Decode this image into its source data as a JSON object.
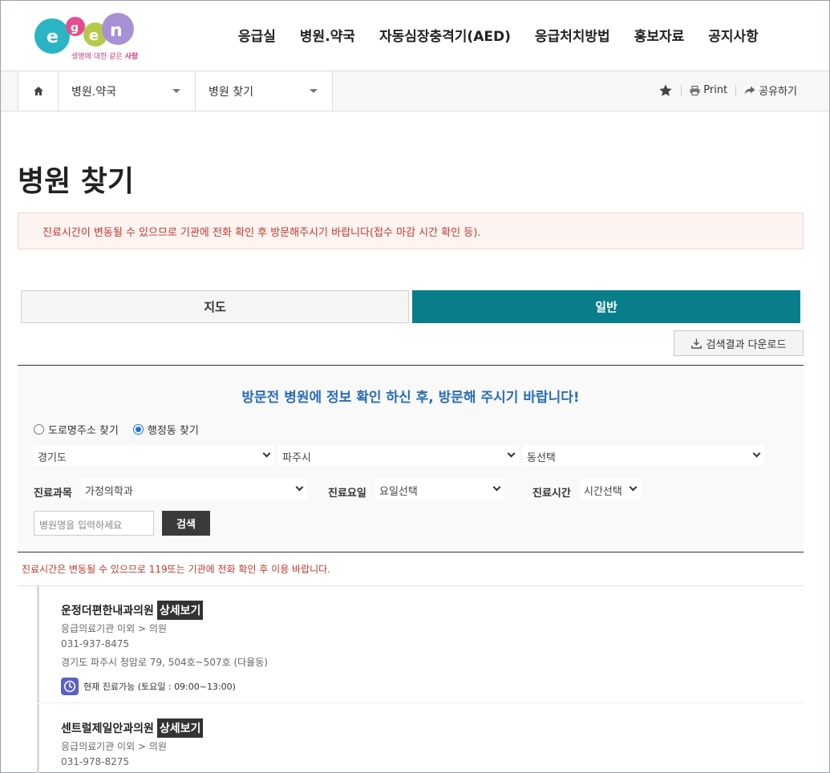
{
  "header": {
    "logo_tagline_a": "생명에 대한 같은",
    "logo_tagline_b": "사랑",
    "nav": [
      "응급실",
      "병원.약국",
      "자동심장충격기(AED)",
      "응급처치방법",
      "홍보자료",
      "공지사항"
    ]
  },
  "breadcrumb": {
    "level1": "병원.약국",
    "level2": "병원 찾기",
    "print": "Print",
    "share": "공유하기"
  },
  "page": {
    "title": "병원 찾기",
    "notice": "진료시간이 변동될 수 있으므로 기관에 전화 확인 후 방문해주시기 바랍니다(접수 마감 시간 확인 등)."
  },
  "tabs": {
    "map": "지도",
    "general": "일반"
  },
  "download_label": "검색결과 다운로드",
  "search": {
    "title": "방문전 병원에 정보 확인 하신 후, 방문해 주시기 바랍니다!",
    "radio_road": "도로명주소 찾기",
    "radio_admin": "행정동 찾기",
    "province": "경기도",
    "city": "파주시",
    "dong": "동선택",
    "dept_label": "진료과목",
    "dept_value": "가정의학과",
    "day_label": "진료요일",
    "day_value": "요일선택",
    "time_label": "진료시간",
    "time_value": "시간선택",
    "name_placeholder": "병원명을 입력하세요",
    "button": "검색"
  },
  "warning": "진료시간은 변동될 수 있으므로 119또는 기관에 전화 확인 후 이용 바랍니다.",
  "results": [
    {
      "name": "운정더편한내과의원",
      "detail": "상세보기",
      "category": "응급의료기관 이외 > 의원",
      "phone": "031-937-8475",
      "address": "경기도 파주시 청암로 79, 504호~507호 (다율동)",
      "status": "현재 진료가능 (토요일 : 09:00~13:00)"
    },
    {
      "name": "센트럴제일안과의원",
      "detail": "상세보기",
      "category": "응급의료기관 이외 > 의원",
      "phone": "031-978-8275"
    }
  ],
  "colors": {
    "accent": "#087e8b",
    "title_blue": "#2a6db4",
    "warning_red": "#c0392b"
  }
}
